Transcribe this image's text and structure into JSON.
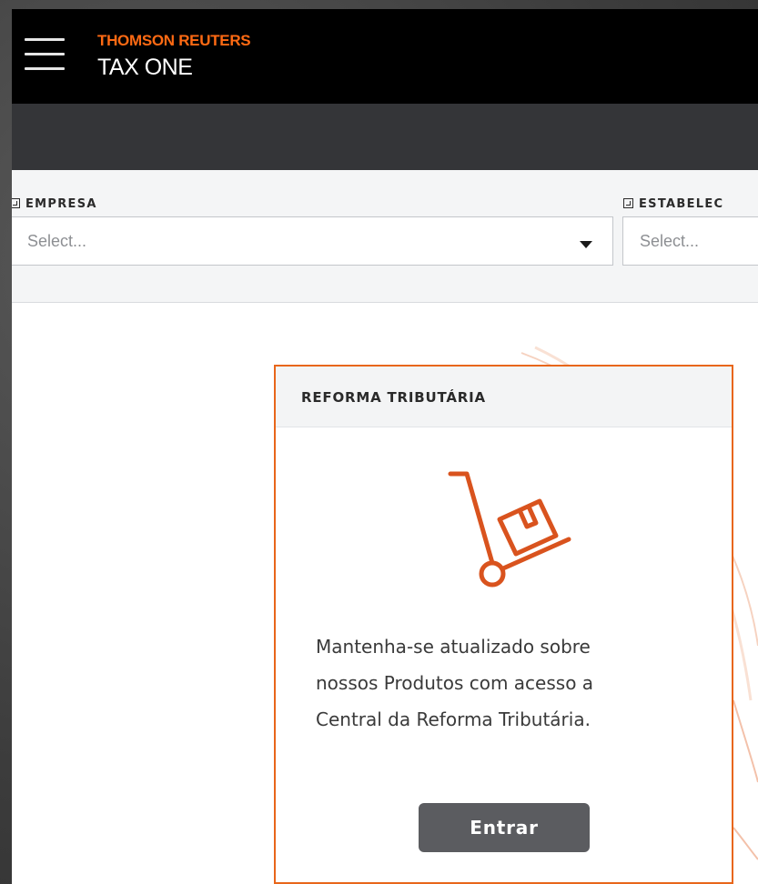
{
  "header": {
    "brand_top": "THOMSON REUTERS",
    "brand_name": "TAX ONE",
    "menu_icon": "hamburger-menu-icon"
  },
  "filters": {
    "empresa": {
      "label": "EMPRESA",
      "placeholder": "Select...",
      "icon": "building-icon"
    },
    "estabelecimento": {
      "label": "ESTABELEC",
      "placeholder": "Select...",
      "icon": "buildings-icon"
    }
  },
  "card": {
    "title": "REFORMA TRIBUTÁRIA",
    "icon": "hand-truck-box-icon",
    "lines": [
      "Mantenha-se atualizado sobre",
      "nossos Produtos com acesso a",
      "Central da Reforma Tributária."
    ],
    "button_label": "Entrar"
  },
  "colors": {
    "brand_orange": "#ff6a13",
    "card_border": "#e8661a",
    "icon_orange": "#d9531e",
    "header_bg": "#000000",
    "subbar_bg": "#343538",
    "button_bg": "#5b5c60"
  }
}
